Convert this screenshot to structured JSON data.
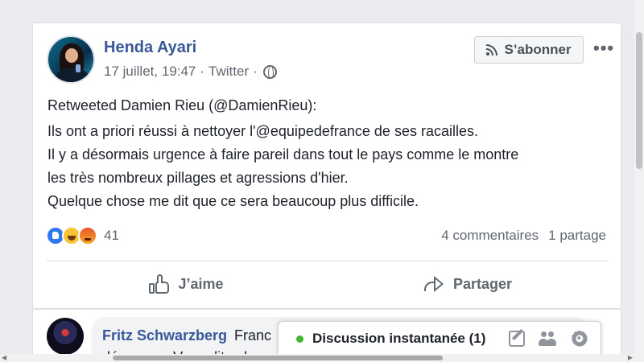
{
  "post": {
    "author": "Henda Ayari",
    "date": "17 juillet, 19:47",
    "source": "Twitter",
    "separator": "·",
    "subscribe_label": "S’abonner",
    "more_label": "•••",
    "retweet_line": "Retweeted Damien Rieu (@DamienRieu):",
    "body_lines": [
      "Ils ont a priori réussi à nettoyer l'@equipedefrance de ses racailles.",
      "Il y a désormais urgence à faire pareil dans tout le pays comme le montre",
      "les très nombreux pillages et agressions d'hier.",
      "Quelque chose me dit que ce sera beaucoup plus difficile."
    ],
    "reaction_count": "41",
    "reactions": [
      "like-reaction",
      "haha-reaction",
      "angry-reaction"
    ],
    "comments_count": "4 commentaires",
    "shares_count": "1 partage",
    "like_label": "J’aime",
    "share_label": "Partager"
  },
  "comment": {
    "author": "Fritz Schwarzberg",
    "text_start": "Franc",
    "text_line2": "dénoncez. Vous dites la v"
  },
  "chat": {
    "label": "Discussion instantanée (1)",
    "status_color": "#42b72a"
  },
  "colors": {
    "link": "#385898",
    "background": "#e9ebee",
    "secondary_text": "#606770"
  }
}
